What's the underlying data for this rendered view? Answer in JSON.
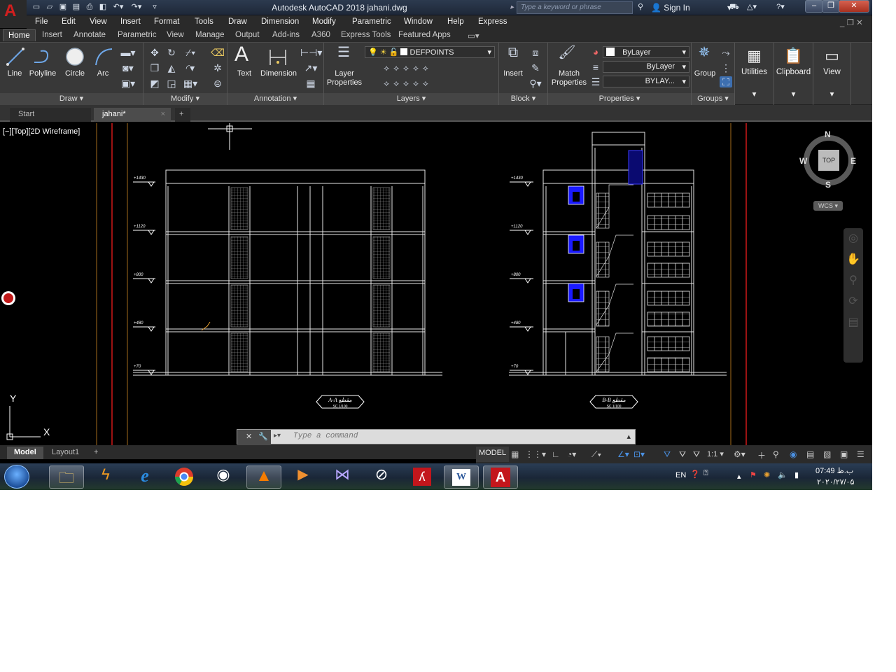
{
  "title_bar": {
    "window_title": "Autodesk AutoCAD 2018    jahani.dwg",
    "search_placeholder": "Type a keyword or phrase",
    "sign_in": "Sign In",
    "app_letter": "A"
  },
  "menu": {
    "items": [
      "File",
      "Edit",
      "View",
      "Insert",
      "Format",
      "Tools",
      "Draw",
      "Dimension",
      "Modify",
      "Parametric",
      "Window",
      "Help",
      "Express"
    ]
  },
  "ribbon_tabs": [
    "Home",
    "Insert",
    "Annotate",
    "Parametric",
    "View",
    "Manage",
    "Output",
    "Add-ins",
    "A360",
    "Express Tools",
    "Featured Apps"
  ],
  "ribbon": {
    "draw": {
      "line": "Line",
      "polyline": "Polyline",
      "circle": "Circle",
      "arc": "Arc",
      "panel": "Draw"
    },
    "modify": {
      "panel": "Modify"
    },
    "annotation": {
      "text": "Text",
      "dimension": "Dimension",
      "panel": "Annotation"
    },
    "layers": {
      "layer_properties_1": "Layer",
      "layer_properties_2": "Properties",
      "current_layer": "DEFPOINTS",
      "panel": "Layers"
    },
    "block": {
      "insert": "Insert",
      "panel": "Block"
    },
    "properties": {
      "match_1": "Match",
      "match_2": "Properties",
      "color": "ByLayer",
      "linetype": "ByLayer",
      "lineweight": "BYLAY...",
      "panel": "Properties"
    },
    "groups": {
      "group": "Group",
      "panel": "Groups"
    },
    "utilities": "Utilities",
    "clipboard": "Clipboard",
    "view": "View"
  },
  "file_tabs": {
    "start": "Start",
    "current": "jahani*",
    "close": "×",
    "new": "+"
  },
  "viewport": {
    "label": "[−][Top][2D Wireframe]",
    "viewcube": {
      "n": "N",
      "s": "S",
      "e": "E",
      "w": "W",
      "top": "TOP",
      "wcs": "WCS"
    },
    "ucs_x": "X",
    "ucs_y": "Y"
  },
  "drawing": {
    "left_levels": [
      "+1430",
      "+1120",
      "+800",
      "+480",
      "+70"
    ],
    "right_levels": [
      "+1430",
      "+1120",
      "+800",
      "+480",
      "+70"
    ],
    "section_a": "A-A مقطع",
    "section_a_scale": "SC 1/100",
    "section_b": "B-B مقطع",
    "section_b_scale": "SC 1/100"
  },
  "command": {
    "placeholder": "Type a command"
  },
  "layout_tabs": {
    "model": "Model",
    "layout1": "Layout1",
    "add": "+"
  },
  "status": {
    "model": "MODEL",
    "scale": "1:1"
  },
  "taskbar": {
    "apps": [
      "explorer",
      "winamp",
      "internet-explorer",
      "chrome",
      "media-player",
      "vlc",
      "movie-maker",
      "visual-studio",
      "cad-tool",
      "acrobat",
      "word",
      "autocad"
    ],
    "lang": "EN",
    "time": "07:49 ب.ظ",
    "date": "۲۰۲۰/۲۷/۰۵"
  },
  "colors": {
    "accent": "#2e6fd6",
    "autocad_red": "#d21f1f",
    "cad_wall": "#e6e6e6",
    "cad_blue": "#1a1aff",
    "viewport_bg": "#000000"
  }
}
